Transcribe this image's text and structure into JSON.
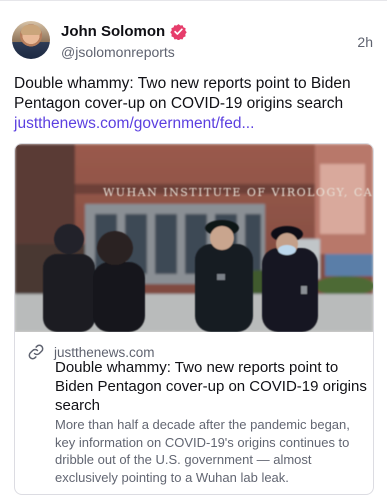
{
  "post": {
    "author_name": "John Solomon",
    "author_handle": "@jsolomonreports",
    "timestamp": "2h",
    "text": "Double whammy: Two new reports point to Biden Pentagon cover-up on COVID-19 origins search",
    "link_text": "justthenews.com/government/fed..."
  },
  "card": {
    "image_sign_text": "WUHAN INSTITUTE OF VIROLOGY, CAS",
    "domain": "justthenews.com",
    "title": "Double whammy: Two new reports point to Biden Pentagon cover-up on COVID-19 origins search",
    "description": "More than half a decade after the pandemic began, key information on COVID-19's origins continues to dribble out of the U.S. government — almost exclusively pointing to a Wuhan lab leak."
  },
  "icons": {
    "verified": "verified-badge-icon",
    "link": "link-chain-icon"
  },
  "colors": {
    "link": "#5b3fe0",
    "verified_badge": "#e63d6b"
  }
}
